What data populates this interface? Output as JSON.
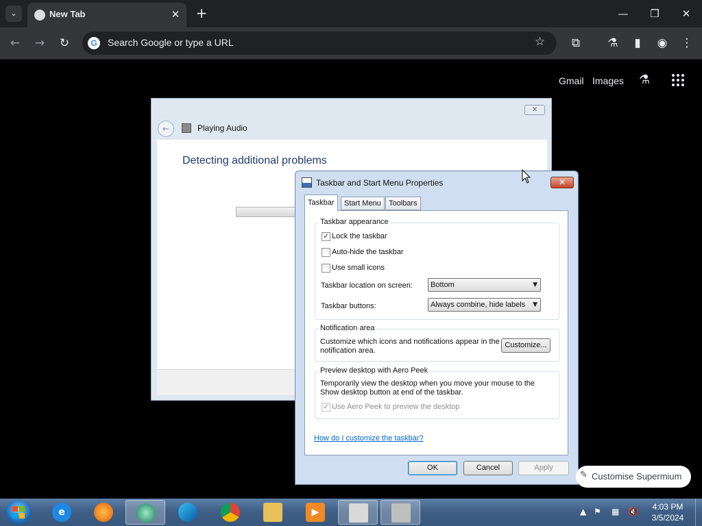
{
  "browser": {
    "tab_title": "New Tab",
    "tab_close": "✕",
    "new_tab": "+",
    "omnibox_placeholder": "Search Google or type a URL",
    "g_letter": "G",
    "ntp_links": [
      "Gmail",
      "Images"
    ],
    "win_controls": {
      "minimize": "—",
      "restore": "❐",
      "close": "✕"
    },
    "toolbar_icons": [
      "back-icon",
      "forward-icon",
      "reload-icon",
      "star-icon",
      "extensions-icon",
      "labs-icon",
      "side-panel-icon",
      "profile-icon",
      "menu-icon"
    ]
  },
  "troubleshooter": {
    "title": "Playing Audio",
    "heading": "Detecting additional problems",
    "close": "✕"
  },
  "dialog": {
    "title": "Taskbar and Start Menu Properties",
    "close": "✕",
    "tabs": [
      "Taskbar",
      "Start Menu",
      "Toolbars"
    ],
    "appearance": {
      "label": "Taskbar appearance",
      "lock": {
        "label": "Lock the taskbar",
        "checked": true
      },
      "autohide": {
        "label": "Auto-hide the taskbar",
        "checked": false
      },
      "small_icons": {
        "label": "Use small icons",
        "checked": false
      },
      "location_label": "Taskbar location on screen:",
      "location_value": "Bottom",
      "buttons_label": "Taskbar buttons:",
      "buttons_value": "Always combine, hide labels"
    },
    "notification": {
      "label": "Notification area",
      "text1": "Customize which icons and notifications appear in the",
      "text2": "notification area.",
      "button": "Customize..."
    },
    "aero": {
      "label": "Preview desktop with Aero Peek",
      "text1": "Temporarily view the desktop when you move your mouse to the",
      "text2": "Show desktop button at end of the taskbar.",
      "checkbox": {
        "label": "Use Aero Peek to preview the desktop",
        "checked": true,
        "disabled": true
      }
    },
    "help_link": "How do I customize the taskbar?",
    "buttons": {
      "ok": "OK",
      "cancel": "Cancel",
      "apply": "Apply"
    }
  },
  "customise_pill": "Customise Supermium",
  "taskbar": {
    "apps": [
      "Internet Explorer",
      "Firefox",
      "Supermium",
      "Edge",
      "Chrome",
      "File Explorer",
      "Media Player",
      "Taskbar Properties",
      "Troubleshooter"
    ],
    "clock_time": "4:03 PM",
    "clock_date": "3/5/2024"
  },
  "colors": {
    "chrome_dark": "#202124",
    "toolbar": "#35363a",
    "accent_blue": "#0066cc"
  }
}
